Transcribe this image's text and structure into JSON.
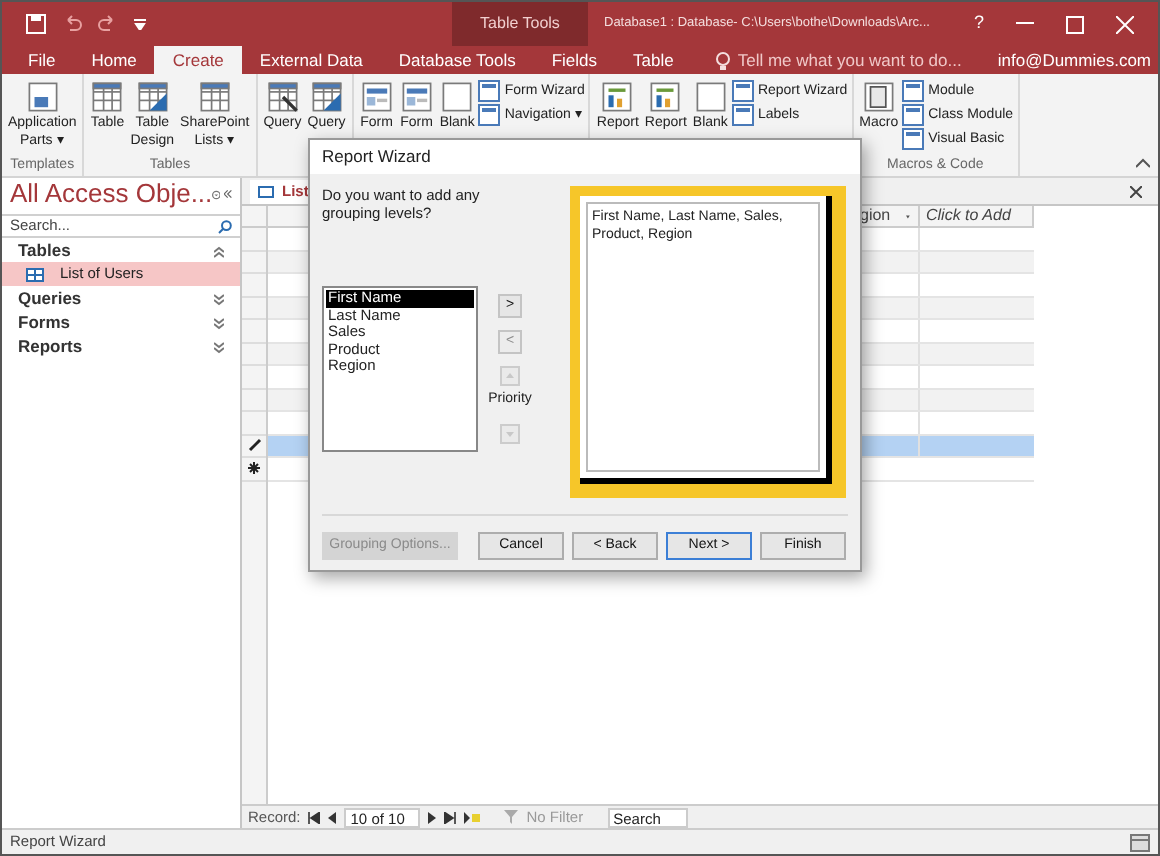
{
  "title_bar": {
    "contextual": "Table Tools",
    "title": "Database1 : Database- C:\\Users\\bothe\\Downloads\\Arc...",
    "help": "?"
  },
  "tabs": [
    {
      "label": "File",
      "selected": false
    },
    {
      "label": "Home",
      "selected": false
    },
    {
      "label": "Create",
      "selected": true
    },
    {
      "label": "External Data",
      "selected": false
    },
    {
      "label": "Database Tools",
      "selected": false
    },
    {
      "label": "Fields",
      "selected": false
    },
    {
      "label": "Table",
      "selected": false
    }
  ],
  "tell_me": {
    "placeholder": "Tell me what you want to do..."
  },
  "account": "info@Dummies.com",
  "ribbon": [
    {
      "label": "Templates",
      "large": [
        {
          "label": "Application",
          "label2": "Parts ▾"
        }
      ]
    },
    {
      "label": "Tables",
      "large": [
        {
          "label": "Table"
        },
        {
          "label": "Table",
          "label2": "Design"
        },
        {
          "label": "SharePoint",
          "label2": "Lists ▾"
        }
      ]
    },
    {
      "large": [
        {
          "label": "Query"
        },
        {
          "label": "Query"
        }
      ]
    },
    {
      "large": [
        {
          "label": "Form"
        },
        {
          "label": "Form"
        },
        {
          "label": "Blank"
        }
      ],
      "small": [
        {
          "label": "Form Wizard"
        },
        {
          "label": "Navigation ▾"
        }
      ]
    },
    {
      "large": [
        {
          "label": "Report"
        },
        {
          "label": "Report"
        },
        {
          "label": "Blank"
        }
      ],
      "small": [
        {
          "label": "Report Wizard"
        },
        {
          "label": "Labels"
        }
      ]
    },
    {
      "label": "Macros & Code",
      "large": [
        {
          "label": "Macro"
        }
      ],
      "small": [
        {
          "label": "Module"
        },
        {
          "label": "Class Module"
        },
        {
          "label": "Visual Basic"
        }
      ]
    }
  ],
  "nav_pane": {
    "title": "All Access Obje...",
    "search": {
      "placeholder": "Search..."
    },
    "sections": [
      {
        "label": "Tables",
        "expanded": true,
        "items": [
          {
            "label": "List of Users",
            "selected": true
          }
        ]
      },
      {
        "label": "Queries",
        "expanded": false
      },
      {
        "label": "Forms",
        "expanded": false
      },
      {
        "label": "Reports",
        "expanded": false
      }
    ]
  },
  "document_tab": {
    "label": "List"
  },
  "datasheet": {
    "columns": [
      "gion",
      "Click to Add"
    ],
    "rows": [
      {
        "selected": false
      },
      {
        "selected": false
      },
      {
        "selected": false
      },
      {
        "selected": false
      },
      {
        "selected": false
      },
      {
        "selected": false
      },
      {
        "selected": false
      },
      {
        "selected": false
      },
      {
        "selected": false
      },
      {
        "selected": true
      }
    ]
  },
  "record_nav": {
    "label": "Record:",
    "position": "10 of 10",
    "filter": "No Filter",
    "search": "Search"
  },
  "dialog": {
    "title": "Report Wizard",
    "question": "Do you want to add any grouping levels?",
    "fields": [
      {
        "label": "First Name",
        "selected": true
      },
      {
        "label": "Last Name",
        "selected": false
      },
      {
        "label": "Sales",
        "selected": false
      },
      {
        "label": "Product",
        "selected": false
      },
      {
        "label": "Region",
        "selected": false
      }
    ],
    "move_buttons": [
      {
        "label": ">",
        "disabled": false
      },
      {
        "label": "<",
        "disabled": true
      }
    ],
    "priority": {
      "label": "Priority",
      "up_disabled": true,
      "down_disabled": true
    },
    "preview": "First Name, Last Name, Sales, Product, Region",
    "buttons": [
      {
        "label": "Grouping Options...",
        "disabled": true,
        "default": false
      },
      {
        "label": "Cancel",
        "disabled": false,
        "default": false
      },
      {
        "label": "< Back",
        "disabled": false,
        "default": false
      },
      {
        "label": "Next >",
        "disabled": false,
        "default": true
      },
      {
        "label": "Finish",
        "disabled": false,
        "default": false
      }
    ]
  },
  "status_bar": {
    "text": "Report Wizard"
  }
}
